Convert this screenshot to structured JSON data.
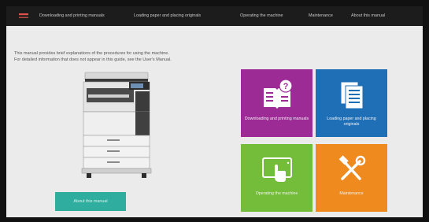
{
  "nav": {
    "items": [
      {
        "label": "Downloading and printing manuals"
      },
      {
        "label": "Loading paper and placing originals"
      },
      {
        "label": "Operating the machine"
      },
      {
        "label": "Maintenance"
      },
      {
        "label": "About this manual"
      }
    ]
  },
  "intro": {
    "line1": "This manual provides brief explanations of the procedures for using the machine.",
    "line2": "For detailed information that does not appear in this guide, see the User's Manual."
  },
  "about_button": {
    "label": "About this manual"
  },
  "tiles": [
    {
      "label": "Downloading and printing manuals",
      "color": "#9d2b96",
      "icon": "book-question-icon"
    },
    {
      "label": "Loading paper and placing originals",
      "color": "#1f6fb7",
      "icon": "documents-icon"
    },
    {
      "label": "Operating the machine",
      "color": "#74bd3b",
      "icon": "touch-panel-icon"
    },
    {
      "label": "Maintenance",
      "color": "#ee8a1e",
      "icon": "tools-icon"
    }
  ]
}
